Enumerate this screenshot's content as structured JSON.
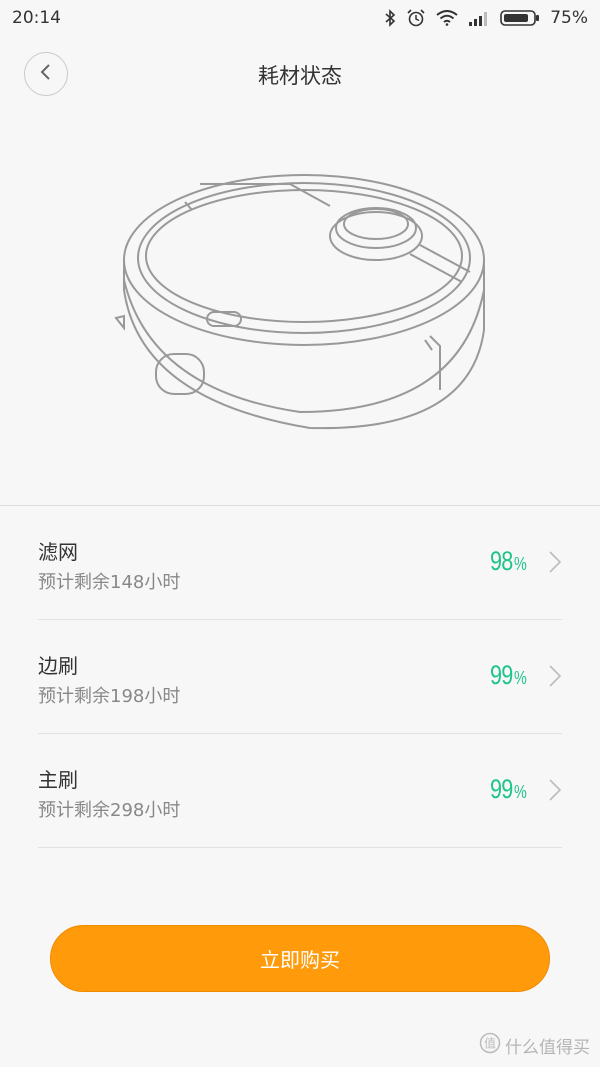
{
  "status_bar": {
    "time": "20:14",
    "battery": "75%",
    "icons": [
      "bluetooth-icon",
      "alarm-icon",
      "wifi-icon",
      "signal-icon",
      "battery-icon"
    ]
  },
  "header": {
    "title": "耗材状态",
    "back_icon": "chevron-left-icon"
  },
  "consumables": [
    {
      "name": "滤网",
      "remaining": "预计剩余148小时",
      "percent": "98",
      "unit": "%"
    },
    {
      "name": "边刷",
      "remaining": "预计剩余198小时",
      "percent": "99",
      "unit": "%"
    },
    {
      "name": "主刷",
      "remaining": "预计剩余298小时",
      "percent": "99",
      "unit": "%"
    }
  ],
  "buy_button": {
    "label": "立即购买"
  },
  "watermark": {
    "text": "什么值得买",
    "icon": "watermark-logo-icon"
  },
  "colors": {
    "accent_green": "#1fc48a",
    "button_orange": "#ff9b0b",
    "background": "#f7f7f7"
  }
}
